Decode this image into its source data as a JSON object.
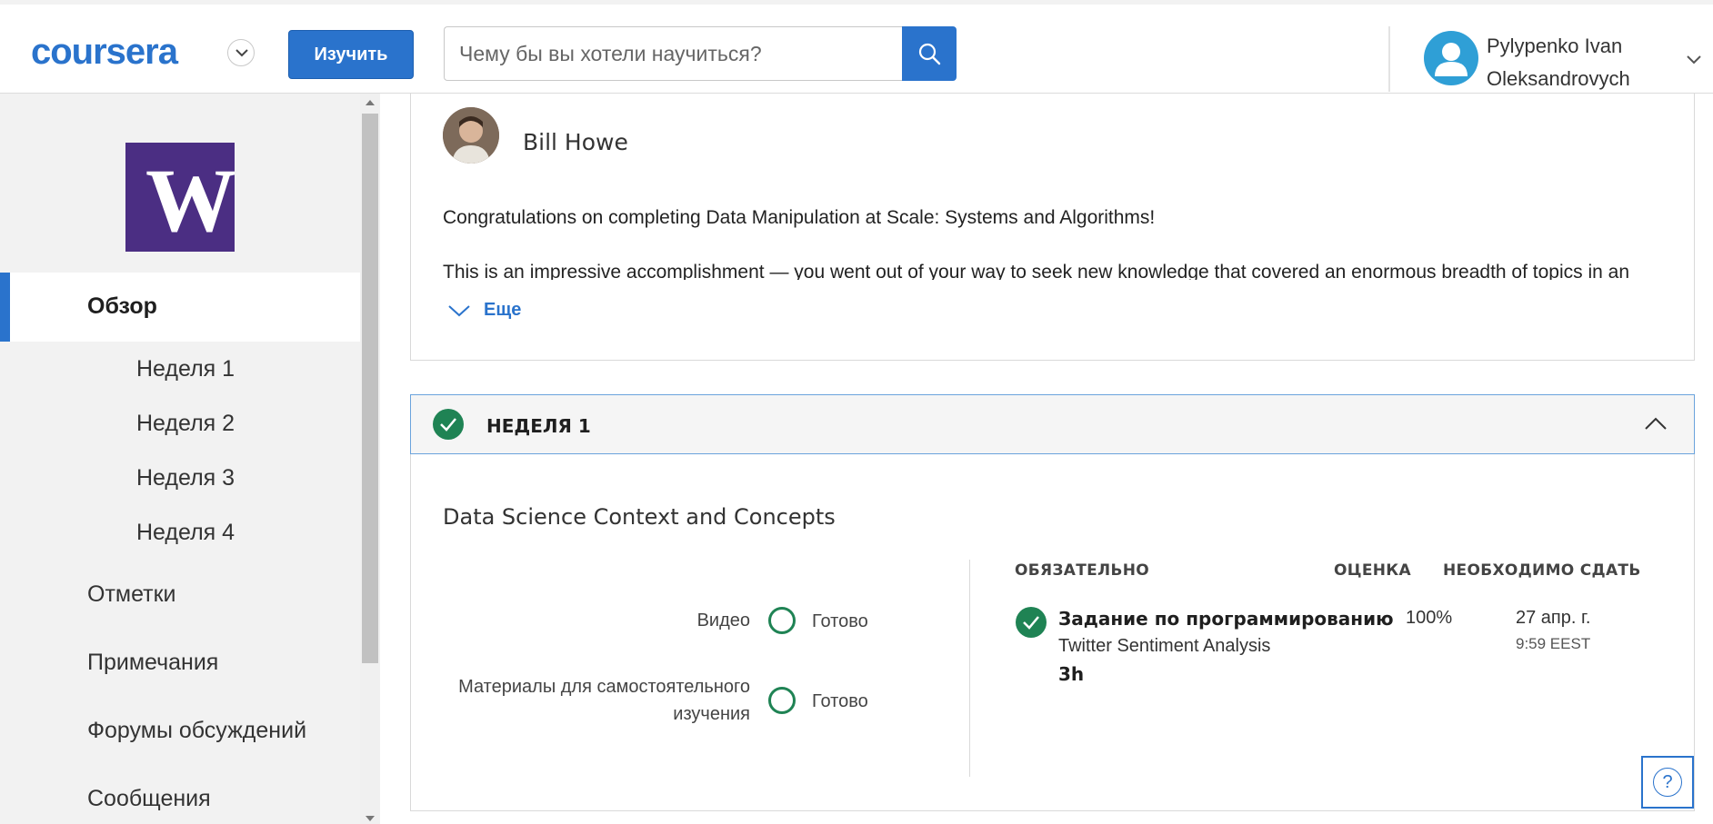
{
  "header": {
    "logo_text": "coursera",
    "explore_label": "Изучить",
    "search_placeholder": "Чему бы вы хотели научиться?",
    "user_name": "Pylypenko Ivan Oleksandrovych"
  },
  "sidebar": {
    "university_logo_letter": "W",
    "items": [
      {
        "label": "Обзор",
        "active": true
      },
      {
        "label": "Неделя 1"
      },
      {
        "label": "Неделя 2"
      },
      {
        "label": "Неделя 3"
      },
      {
        "label": "Неделя 4"
      },
      {
        "label": "Отметки"
      },
      {
        "label": "Примечания"
      },
      {
        "label": "Форумы обсуждений"
      },
      {
        "label": "Сообщения"
      }
    ]
  },
  "instructor": {
    "name": "Bill Howe",
    "message_line1": "Congratulations on completing Data Manipulation at Scale: Systems and Algorithms!",
    "message_line2": "This is an impressive accomplishment — you went out of your way to seek new knowledge that covered an enormous breadth of topics in an",
    "more_label": "Еще"
  },
  "week": {
    "title": "НЕДЕЛЯ 1",
    "module_title": "Data Science Context and Concepts",
    "progress": [
      {
        "label": "Видео",
        "status": "Готово"
      },
      {
        "label_line1": "Материалы для самостоятельного",
        "label_line2": "изучения",
        "status": "Готово"
      }
    ],
    "columns": {
      "required": "ОБЯЗАТЕЛЬНО",
      "grade": "ОЦЕНКА",
      "due": "НЕОБХОДИМО СДАТЬ"
    },
    "assignment": {
      "title": "Задание по программированию",
      "subtitle": "Twitter Sentiment Analysis",
      "duration": "3h",
      "grade": "100%",
      "due_date": "27 апр. г.",
      "due_time": "9:59 EEST"
    }
  },
  "help": {
    "label": "?"
  },
  "colors": {
    "accent": "#2a73cc",
    "success": "#1f8354",
    "uw_purple": "#4b2e83",
    "sidebar_bg": "#f2f2f2"
  }
}
